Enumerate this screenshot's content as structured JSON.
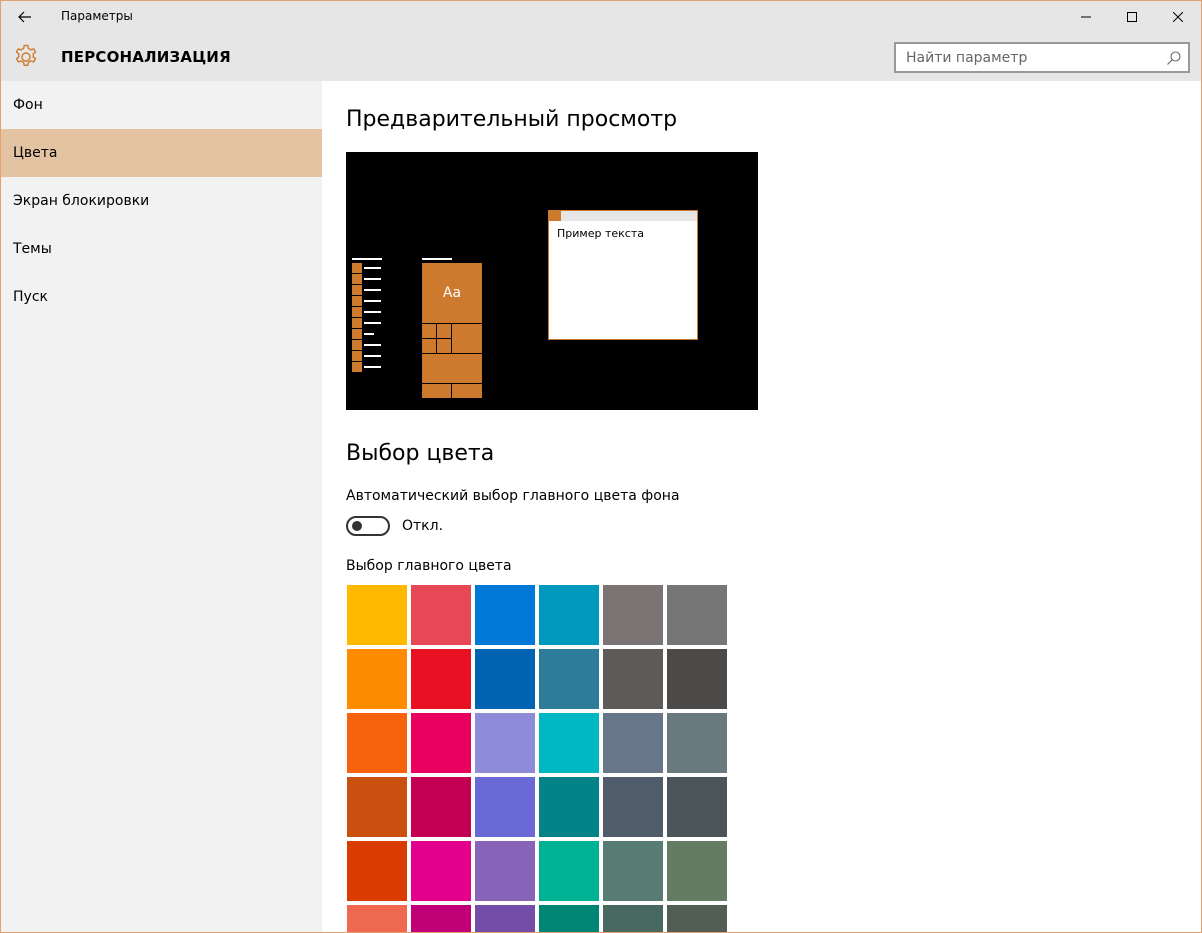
{
  "window": {
    "title": "Параметры",
    "back_icon": "arrow-left",
    "minimize_icon": "minimize",
    "maximize_icon": "maximize",
    "close_icon": "close"
  },
  "header": {
    "icon": "gear-icon",
    "title": "ПЕРСОНАЛИЗАЦИЯ",
    "accent_color": "#ce7a2e",
    "search_placeholder": "Найти параметр",
    "search_icon": "search-icon"
  },
  "sidebar": {
    "items": [
      {
        "label": "Фон",
        "active": false
      },
      {
        "label": "Цвета",
        "active": true
      },
      {
        "label": "Экран блокировки",
        "active": false
      },
      {
        "label": "Темы",
        "active": false
      },
      {
        "label": "Пуск",
        "active": false
      }
    ],
    "active_color": "#e3c3a2"
  },
  "main": {
    "preview_heading": "Предварительный просмотр",
    "preview_tile_text": "Aa",
    "preview_window_text": "Пример текста",
    "color_heading": "Выбор цвета",
    "auto_label": "Автоматический выбор главного цвета фона",
    "toggle_state": "Откл.",
    "toggle_on": false,
    "pick_label": "Выбор главного цвета",
    "swatches": [
      [
        "#ffb900",
        "#e74856",
        "#0078d7",
        "#0099bc",
        "#7a7574",
        "#767676"
      ],
      [
        "#ff8c00",
        "#e81123",
        "#0063b1",
        "#2d7d9a",
        "#5d5a58",
        "#4c4a48"
      ],
      [
        "#f7630c",
        "#ea005e",
        "#8e8cd8",
        "#00b7c3",
        "#68768a",
        "#69797e"
      ],
      [
        "#ca5010",
        "#c30052",
        "#6b69d6",
        "#038387",
        "#515c6b",
        "#4a5459"
      ],
      [
        "#da3b01",
        "#e3008c",
        "#8764b8",
        "#00b294",
        "#567c73",
        "#647c64"
      ],
      [
        "#ef6950",
        "#bf0077",
        "#744da9",
        "#018574",
        "#486860",
        "#525e54"
      ]
    ]
  }
}
